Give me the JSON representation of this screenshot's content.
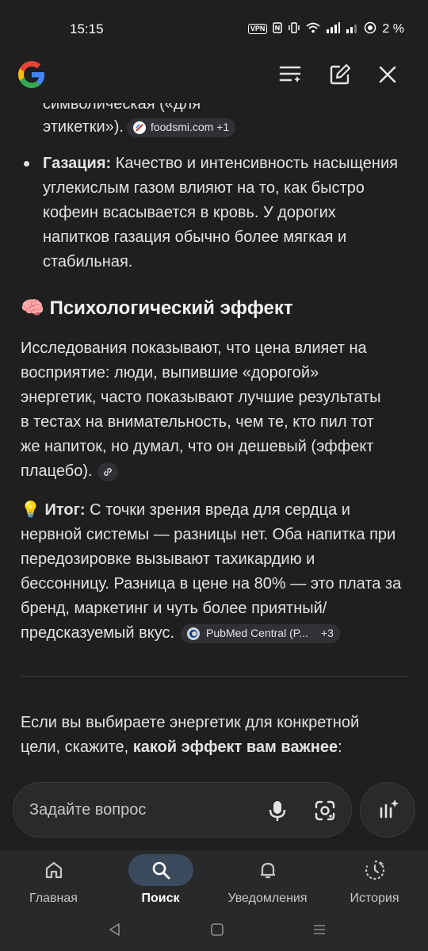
{
  "status_bar": {
    "time": "15:15",
    "vpn": "VPN",
    "battery": "2 %"
  },
  "app_bar": {
    "logo": "google-logo",
    "actions": [
      "history-list-icon",
      "edit-icon",
      "close-icon"
    ]
  },
  "content": {
    "partial_line_1": "символическая («для",
    "partial_line_2": "этикетки»).",
    "chip_1": "foodsmi.com +1",
    "bullet_gazation": {
      "title": "Газация:",
      "lines": [
        "Качество и интенсивность насыщения",
        "углекислым газом влияют на то, как быстро",
        "кофеин всасывается в кровь. У дорогих",
        "напитков газация обычно более мягкая и",
        "стабильная."
      ]
    },
    "heading_psych": {
      "emoji": "🧠",
      "text": "Психологический эффект"
    },
    "psych_paragraph": [
      "Исследования показывают, что цена влияет на",
      "восприятие: люди, выпившие «дорогой»",
      "энергетик, часто показывают лучшие результаты",
      "в тестах на внимательность, чем те, кто пил тот",
      "же напиток, но думал, что он дешевый (эффект",
      "плацебо)."
    ],
    "summary": {
      "emoji": "💡",
      "title": "Итог:",
      "lines": [
        "С точки зрения вреда для сердца и",
        "нервной системы — разницы нет. Оба напитка при",
        "передозировке вызывают тахикардию и",
        "бессонницу. Разница в цене на 80% — это плата за",
        "бренд, маркетинг и чуть более приятный/",
        "предсказуемый вкус."
      ],
      "chip": "PubMed Central (P...",
      "chip_count": "+3"
    },
    "followup": {
      "line1": "Если вы выбираете энергетик для конкретной",
      "line2_plain": "цели, скажите, ",
      "line2_bold": "какой эффект вам важнее",
      "line2_end": ":"
    }
  },
  "ask": {
    "placeholder": "Задайте вопрос"
  },
  "bottom_nav": {
    "items": [
      {
        "label": "Главная",
        "icon": "home-icon"
      },
      {
        "label": "Поиск",
        "icon": "search-icon",
        "active": true
      },
      {
        "label": "Уведомления",
        "icon": "bell-icon"
      },
      {
        "label": "История",
        "icon": "history-icon"
      }
    ]
  },
  "colors": {
    "background": "#1f1f1f",
    "text": "#e3e3e3",
    "chip": "#303134",
    "nav_active_pill": "#3c4a5e"
  }
}
